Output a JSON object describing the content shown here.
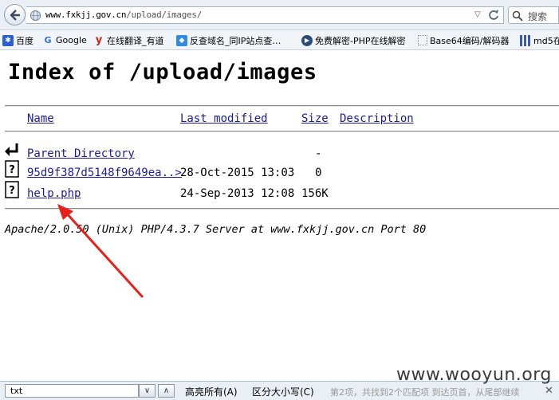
{
  "url": {
    "host": "www.fxkjj.gov.cn",
    "path": "/upload/images/"
  },
  "search": {
    "placeholder": "搜索"
  },
  "bookmarks": [
    {
      "label": "百度",
      "icon": "paw-icon"
    },
    {
      "label": "Google",
      "icon": "google-g-icon"
    },
    {
      "label": "在线翻译_有道",
      "icon": "youdao-icon"
    },
    {
      "label": "反查域名_同IP站点查…",
      "icon": "domain-icon"
    },
    {
      "label": "免费解密-PHP在线解密",
      "icon": "unlock-icon"
    },
    {
      "label": "Base64编码/解码器",
      "icon": "page-icon"
    },
    {
      "label": "md5在",
      "icon": "grid-icon"
    }
  ],
  "page": {
    "title": "Index of /upload/images",
    "columns": {
      "name": "Name",
      "modified": "Last modified",
      "size": "Size",
      "description": "Description"
    },
    "parent": {
      "name": "Parent Directory",
      "size": "-"
    },
    "files": [
      {
        "name": "95d9f387d5148f9649ea..>",
        "modified": "28-Oct-2015 13:03",
        "size": "0"
      },
      {
        "name": "help.php",
        "modified": "24-Sep-2013 12:08",
        "size": "156K"
      }
    ],
    "address": "Apache/2.0.50 (Unix) PHP/4.3.7 Server at www.fxkjj.gov.cn Port 80"
  },
  "findbar": {
    "value": "txt",
    "highlight_all": "高亮所有(A)",
    "match_case": "区分大小写(C)",
    "status": "第2项，共找到2个匹配项   到达页首，从尾部继续"
  },
  "watermark": "www.wooyun.org"
}
